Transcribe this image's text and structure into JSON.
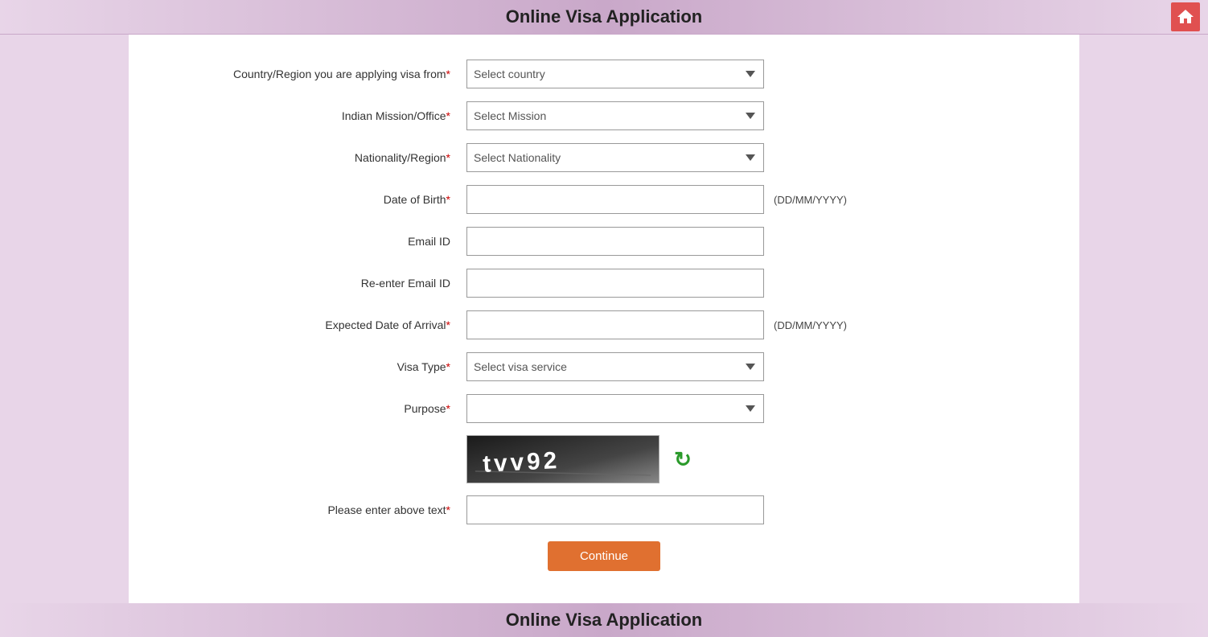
{
  "header": {
    "title": "Online Visa Application"
  },
  "footer": {
    "title": "Online Visa Application"
  },
  "form": {
    "fields": {
      "country_label": "Country/Region you are applying visa from",
      "country_required": true,
      "country_placeholder": "Select country",
      "mission_label": "Indian Mission/Office",
      "mission_required": true,
      "mission_placeholder": "Select Mission",
      "nationality_label": "Nationality/Region",
      "nationality_required": true,
      "nationality_placeholder": "Select Nationality",
      "dob_label": "Date of Birth",
      "dob_required": true,
      "dob_hint": "(DD/MM/YYYY)",
      "email_label": "Email ID",
      "email_required": false,
      "re_email_label": "Re-enter Email ID",
      "re_email_required": false,
      "arrival_label": "Expected Date of Arrival",
      "arrival_required": true,
      "arrival_hint": "(DD/MM/YYYY)",
      "visa_type_label": "Visa Type",
      "visa_type_required": true,
      "visa_type_placeholder": "Select visa service",
      "purpose_label": "Purpose",
      "purpose_required": true,
      "captcha_text": "tvv92",
      "captcha_input_label": "Please enter above text",
      "captcha_required": true,
      "continue_button": "Continue"
    }
  },
  "icons": {
    "home": "🏠",
    "refresh": "↻",
    "dropdown_arrow": "▼"
  }
}
